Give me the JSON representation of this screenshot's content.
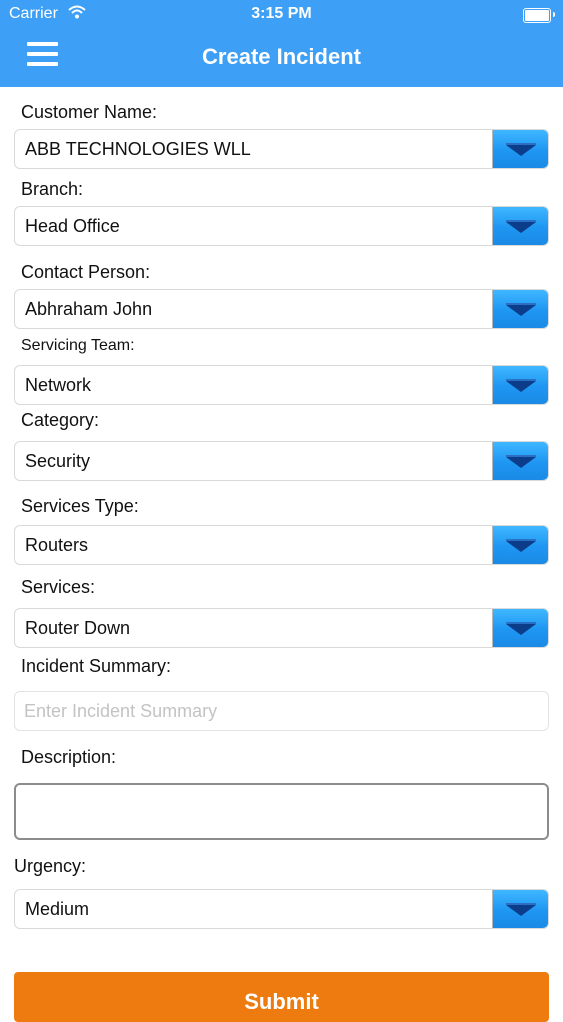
{
  "status_bar": {
    "carrier": "Carrier",
    "time": "3:15 PM"
  },
  "navbar": {
    "title": "Create Incident",
    "menu_icon": "hamburger-menu-icon"
  },
  "form": {
    "customer_name": {
      "label": "Customer Name:",
      "value": "ABB TECHNOLOGIES WLL"
    },
    "branch": {
      "label": "Branch:",
      "value": "Head Office"
    },
    "contact_person": {
      "label": "Contact Person:",
      "value": "Abhraham John"
    },
    "servicing_team": {
      "label": "Servicing Team:",
      "value": "Network"
    },
    "category": {
      "label": "Category:",
      "value": "Security"
    },
    "services_type": {
      "label": "Services Type:",
      "value": "Routers"
    },
    "services": {
      "label": "Services:",
      "value": "Router Down"
    },
    "incident_summary": {
      "label": "Incident Summary:",
      "value": "",
      "placeholder": "Enter Incident Summary"
    },
    "description": {
      "label": "Description:",
      "value": ""
    },
    "urgency": {
      "label": "Urgency:",
      "value": "Medium"
    },
    "submit_label": "Submit"
  },
  "colors": {
    "header": "#3d9ff5",
    "dropdown_button": "#1e96f2",
    "submit": "#ee7b10"
  }
}
